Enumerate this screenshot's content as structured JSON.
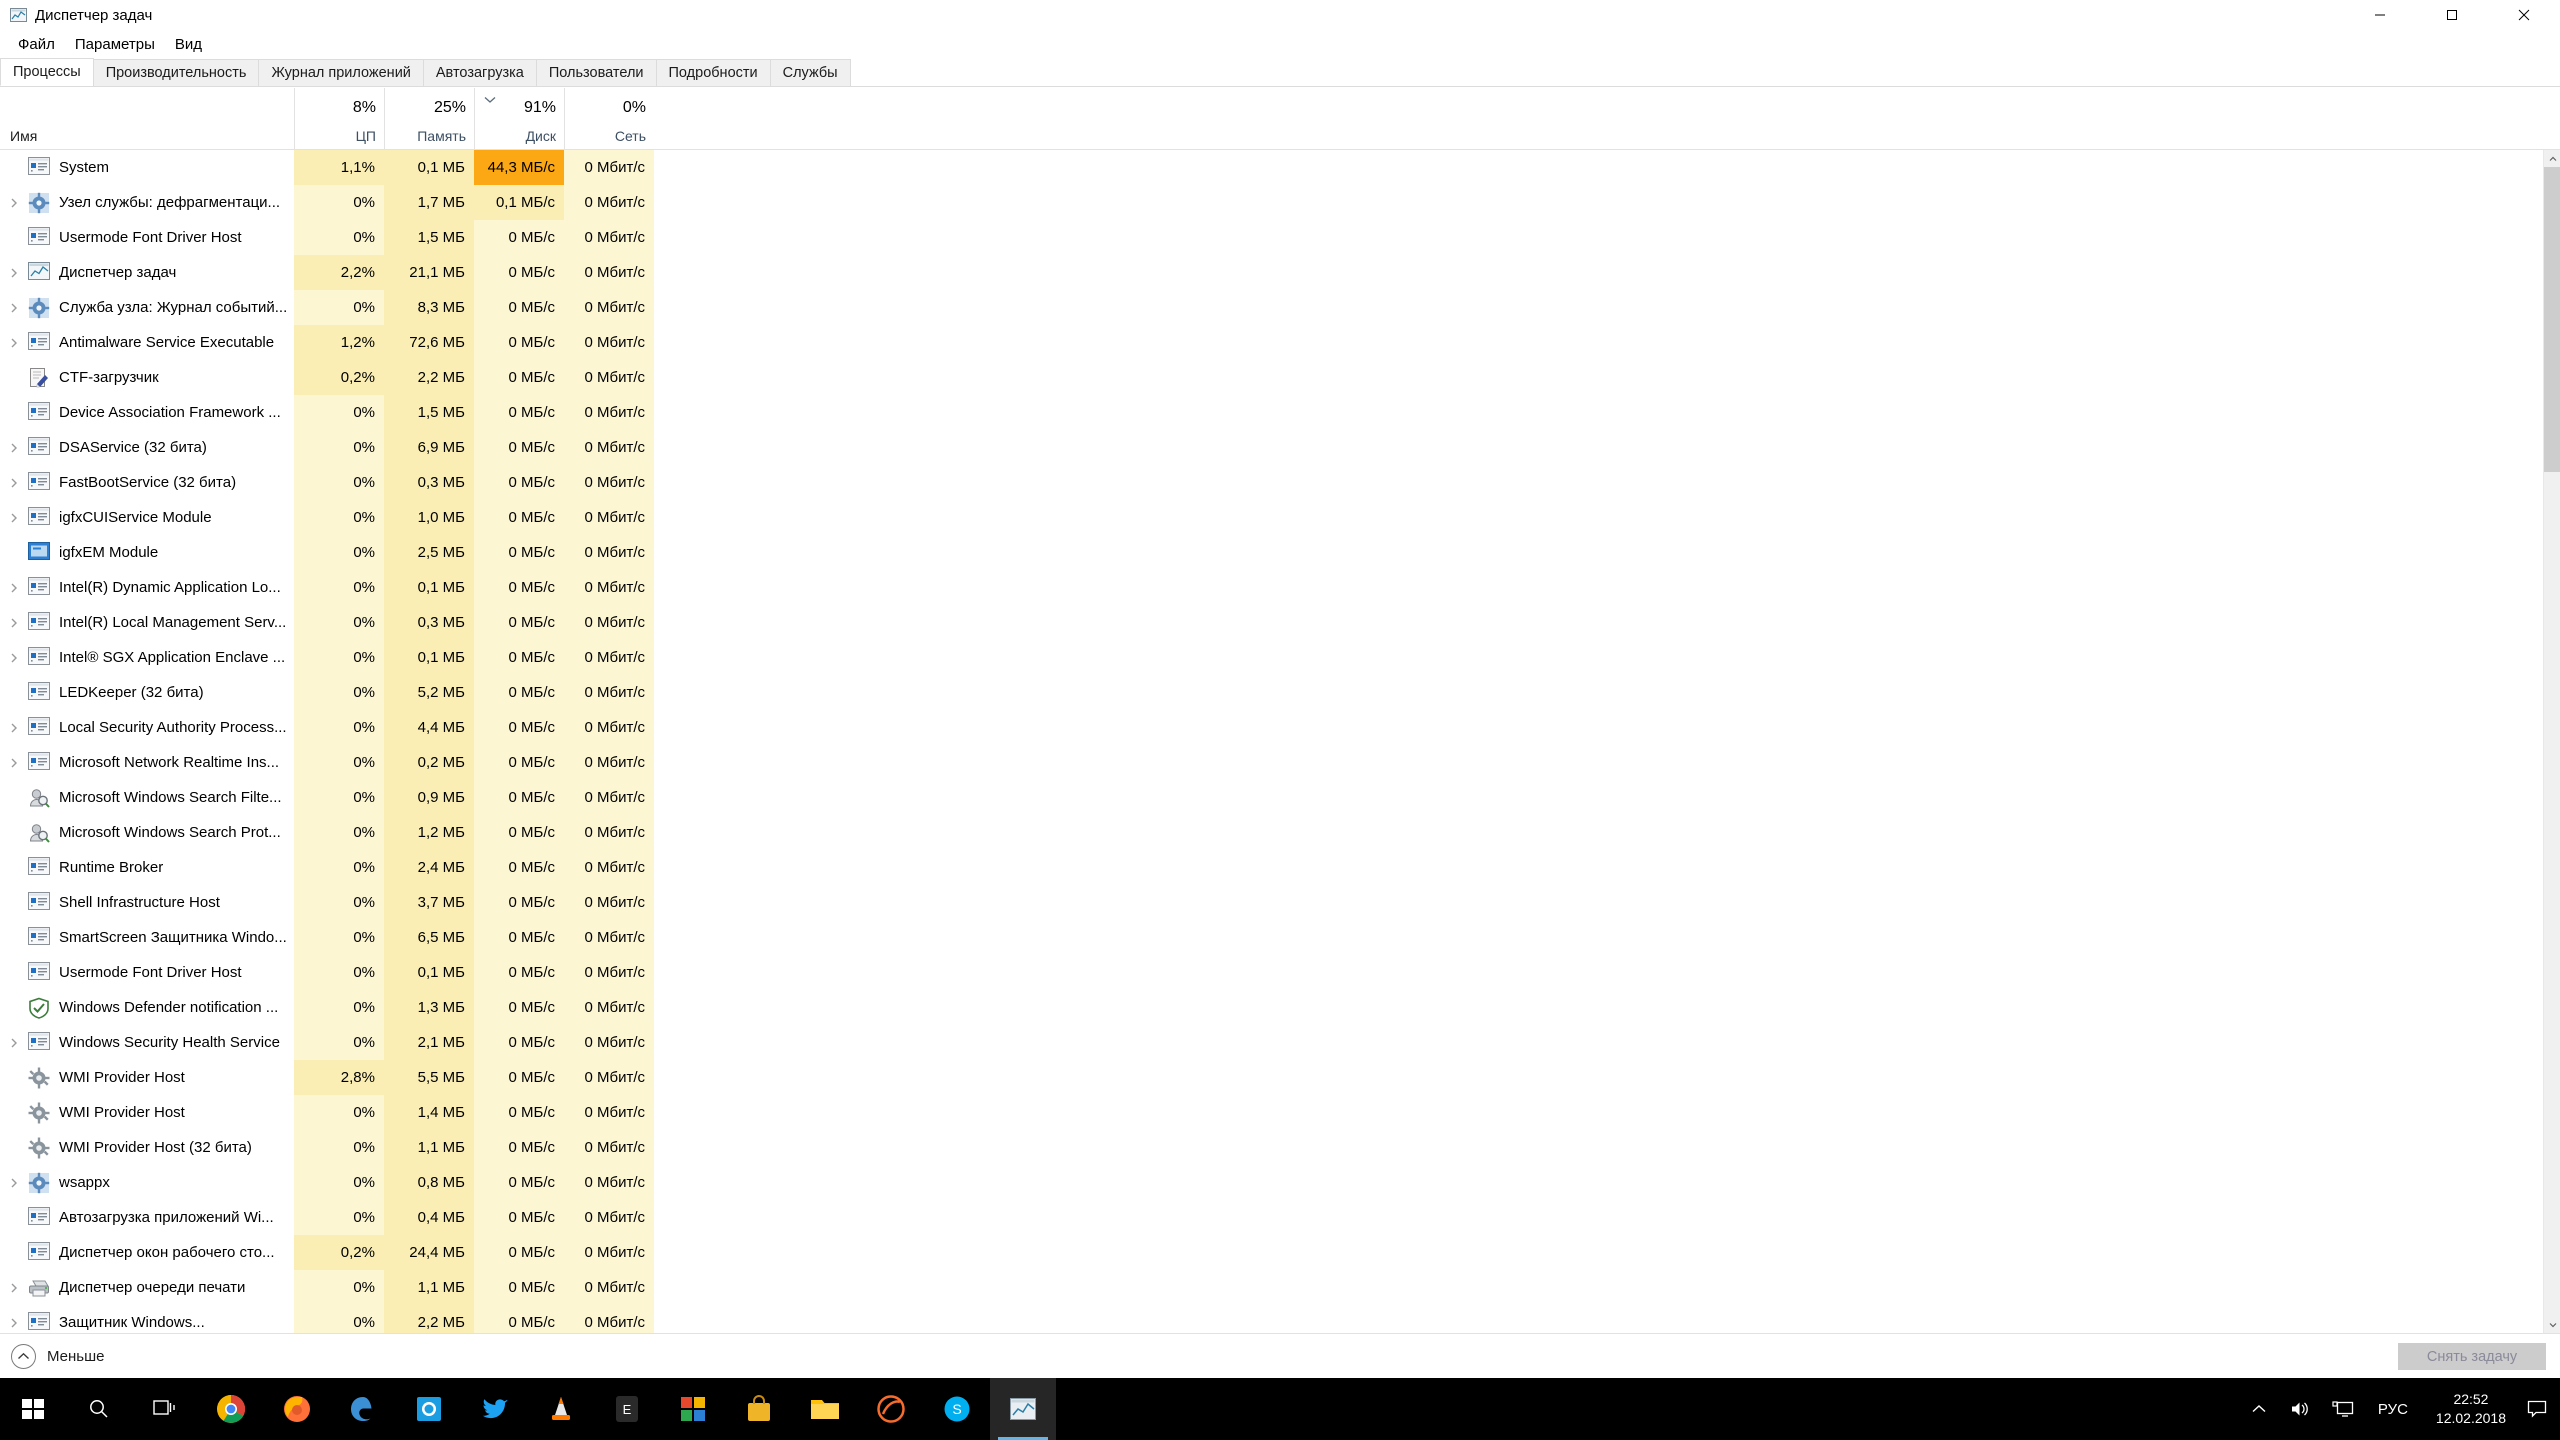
{
  "window": {
    "title": "Диспетчер задач",
    "icon": "task-manager-icon",
    "minimize_label": "—",
    "maximize_label": "▢",
    "close_label": "✕"
  },
  "menu": {
    "items": [
      {
        "label": "Файл"
      },
      {
        "label": "Параметры"
      },
      {
        "label": "Вид"
      }
    ]
  },
  "tabs": {
    "active_index": 0,
    "items": [
      {
        "label": "Процессы"
      },
      {
        "label": "Производительность"
      },
      {
        "label": "Журнал приложений"
      },
      {
        "label": "Автозагрузка"
      },
      {
        "label": "Пользователи"
      },
      {
        "label": "Подробности"
      },
      {
        "label": "Службы"
      }
    ]
  },
  "columns": [
    {
      "key": "name",
      "top": "",
      "label": "Имя",
      "sorted": false
    },
    {
      "key": "cpu",
      "top": "8%",
      "label": "ЦП",
      "sorted": false
    },
    {
      "key": "memory",
      "top": "25%",
      "label": "Память",
      "sorted": false
    },
    {
      "key": "disk",
      "top": "91%",
      "label": "Диск",
      "sorted": true
    },
    {
      "key": "net",
      "top": "0%",
      "label": "Сеть",
      "sorted": false
    }
  ],
  "sort": {
    "column": "disk",
    "direction": "descending",
    "indicator": "chevron-down-icon"
  },
  "processes": [
    {
      "name": "System",
      "icon": "window-icon",
      "expandable": false,
      "cpu": "1,1%",
      "memory": "0,1 МБ",
      "disk": "44,3 МБ/с",
      "net": "0 Мбит/с",
      "heat": {
        "cpu": 2,
        "memory": 2,
        "disk": 4,
        "net": 1
      }
    },
    {
      "name": "Узел службы: дефрагментаци...",
      "icon": "gear-icon",
      "expandable": true,
      "cpu": "0%",
      "memory": "1,7 МБ",
      "disk": "0,1 МБ/с",
      "net": "0 Мбит/с",
      "heat": {
        "cpu": 1,
        "memory": 2,
        "disk": 2,
        "net": 1
      }
    },
    {
      "name": "Usermode Font Driver Host",
      "icon": "window-icon",
      "expandable": false,
      "cpu": "0%",
      "memory": "1,5 МБ",
      "disk": "0 МБ/с",
      "net": "0 Мбит/с",
      "heat": {
        "cpu": 1,
        "memory": 2,
        "disk": 1,
        "net": 1
      }
    },
    {
      "name": "Диспетчер задач",
      "icon": "task-manager-icon",
      "expandable": true,
      "cpu": "2,2%",
      "memory": "21,1 МБ",
      "disk": "0 МБ/с",
      "net": "0 Мбит/с",
      "heat": {
        "cpu": 2,
        "memory": 2,
        "disk": 1,
        "net": 1
      }
    },
    {
      "name": "Служба узла: Журнал событий...",
      "icon": "gear-icon",
      "expandable": true,
      "cpu": "0%",
      "memory": "8,3 МБ",
      "disk": "0 МБ/с",
      "net": "0 Мбит/с",
      "heat": {
        "cpu": 1,
        "memory": 2,
        "disk": 1,
        "net": 1
      }
    },
    {
      "name": "Antimalware Service Executable",
      "icon": "window-icon",
      "expandable": true,
      "cpu": "1,2%",
      "memory": "72,6 МБ",
      "disk": "0 МБ/с",
      "net": "0 Мбит/с",
      "heat": {
        "cpu": 2,
        "memory": 2,
        "disk": 1,
        "net": 1
      }
    },
    {
      "name": "CTF-загрузчик",
      "icon": "pen-document-icon",
      "expandable": false,
      "cpu": "0,2%",
      "memory": "2,2 МБ",
      "disk": "0 МБ/с",
      "net": "0 Мбит/с",
      "heat": {
        "cpu": 2,
        "memory": 2,
        "disk": 1,
        "net": 1
      }
    },
    {
      "name": "Device Association Framework ...",
      "icon": "window-icon",
      "expandable": false,
      "cpu": "0%",
      "memory": "1,5 МБ",
      "disk": "0 МБ/с",
      "net": "0 Мбит/с",
      "heat": {
        "cpu": 1,
        "memory": 2,
        "disk": 1,
        "net": 1
      }
    },
    {
      "name": "DSAService (32 бита)",
      "icon": "window-icon",
      "expandable": true,
      "cpu": "0%",
      "memory": "6,9 МБ",
      "disk": "0 МБ/с",
      "net": "0 Мбит/с",
      "heat": {
        "cpu": 1,
        "memory": 2,
        "disk": 1,
        "net": 1
      }
    },
    {
      "name": "FastBootService (32 бита)",
      "icon": "window-icon",
      "expandable": true,
      "cpu": "0%",
      "memory": "0,3 МБ",
      "disk": "0 МБ/с",
      "net": "0 Мбит/с",
      "heat": {
        "cpu": 1,
        "memory": 2,
        "disk": 1,
        "net": 1
      }
    },
    {
      "name": "igfxCUIService Module",
      "icon": "window-icon",
      "expandable": true,
      "cpu": "0%",
      "memory": "1,0 МБ",
      "disk": "0 МБ/с",
      "net": "0 Мбит/с",
      "heat": {
        "cpu": 1,
        "memory": 2,
        "disk": 1,
        "net": 1
      }
    },
    {
      "name": "igfxEM Module",
      "icon": "blue-app-icon",
      "expandable": false,
      "cpu": "0%",
      "memory": "2,5 МБ",
      "disk": "0 МБ/с",
      "net": "0 Мбит/с",
      "heat": {
        "cpu": 1,
        "memory": 2,
        "disk": 1,
        "net": 1
      }
    },
    {
      "name": "Intel(R) Dynamic Application Lo...",
      "icon": "window-icon",
      "expandable": true,
      "cpu": "0%",
      "memory": "0,1 МБ",
      "disk": "0 МБ/с",
      "net": "0 Мбит/с",
      "heat": {
        "cpu": 1,
        "memory": 2,
        "disk": 1,
        "net": 1
      }
    },
    {
      "name": "Intel(R) Local Management Serv...",
      "icon": "window-icon",
      "expandable": true,
      "cpu": "0%",
      "memory": "0,3 МБ",
      "disk": "0 МБ/с",
      "net": "0 Мбит/с",
      "heat": {
        "cpu": 1,
        "memory": 2,
        "disk": 1,
        "net": 1
      }
    },
    {
      "name": "Intel® SGX Application Enclave ...",
      "icon": "window-icon",
      "expandable": true,
      "cpu": "0%",
      "memory": "0,1 МБ",
      "disk": "0 МБ/с",
      "net": "0 Мбит/с",
      "heat": {
        "cpu": 1,
        "memory": 2,
        "disk": 1,
        "net": 1
      }
    },
    {
      "name": "LEDKeeper (32 бита)",
      "icon": "window-icon",
      "expandable": false,
      "cpu": "0%",
      "memory": "5,2 МБ",
      "disk": "0 МБ/с",
      "net": "0 Мбит/с",
      "heat": {
        "cpu": 1,
        "memory": 2,
        "disk": 1,
        "net": 1
      }
    },
    {
      "name": "Local Security Authority Process...",
      "icon": "window-icon",
      "expandable": true,
      "cpu": "0%",
      "memory": "4,4 МБ",
      "disk": "0 МБ/с",
      "net": "0 Мбит/с",
      "heat": {
        "cpu": 1,
        "memory": 2,
        "disk": 1,
        "net": 1
      }
    },
    {
      "name": "Microsoft Network Realtime Ins...",
      "icon": "window-icon",
      "expandable": true,
      "cpu": "0%",
      "memory": "0,2 МБ",
      "disk": "0 МБ/с",
      "net": "0 Мбит/с",
      "heat": {
        "cpu": 1,
        "memory": 2,
        "disk": 1,
        "net": 1
      }
    },
    {
      "name": "Microsoft Windows Search Filte...",
      "icon": "search-person-icon",
      "expandable": false,
      "cpu": "0%",
      "memory": "0,9 МБ",
      "disk": "0 МБ/с",
      "net": "0 Мбит/с",
      "heat": {
        "cpu": 1,
        "memory": 2,
        "disk": 1,
        "net": 1
      }
    },
    {
      "name": "Microsoft Windows Search Prot...",
      "icon": "search-person-icon",
      "expandable": false,
      "cpu": "0%",
      "memory": "1,2 МБ",
      "disk": "0 МБ/с",
      "net": "0 Мбит/с",
      "heat": {
        "cpu": 1,
        "memory": 2,
        "disk": 1,
        "net": 1
      }
    },
    {
      "name": "Runtime Broker",
      "icon": "window-icon",
      "expandable": false,
      "cpu": "0%",
      "memory": "2,4 МБ",
      "disk": "0 МБ/с",
      "net": "0 Мбит/с",
      "heat": {
        "cpu": 1,
        "memory": 2,
        "disk": 1,
        "net": 1
      }
    },
    {
      "name": "Shell Infrastructure Host",
      "icon": "window-icon",
      "expandable": false,
      "cpu": "0%",
      "memory": "3,7 МБ",
      "disk": "0 МБ/с",
      "net": "0 Мбит/с",
      "heat": {
        "cpu": 1,
        "memory": 2,
        "disk": 1,
        "net": 1
      }
    },
    {
      "name": "SmartScreen Защитника Windo...",
      "icon": "window-icon",
      "expandable": false,
      "cpu": "0%",
      "memory": "6,5 МБ",
      "disk": "0 МБ/с",
      "net": "0 Мбит/с",
      "heat": {
        "cpu": 1,
        "memory": 2,
        "disk": 1,
        "net": 1
      }
    },
    {
      "name": "Usermode Font Driver Host",
      "icon": "window-icon",
      "expandable": false,
      "cpu": "0%",
      "memory": "0,1 МБ",
      "disk": "0 МБ/с",
      "net": "0 Мбит/с",
      "heat": {
        "cpu": 1,
        "memory": 2,
        "disk": 1,
        "net": 1
      }
    },
    {
      "name": "Windows Defender notification ...",
      "icon": "shield-icon",
      "expandable": false,
      "cpu": "0%",
      "memory": "1,3 МБ",
      "disk": "0 МБ/с",
      "net": "0 Мбит/с",
      "heat": {
        "cpu": 1,
        "memory": 2,
        "disk": 1,
        "net": 1
      }
    },
    {
      "name": "Windows Security Health Service",
      "icon": "window-icon",
      "expandable": true,
      "cpu": "0%",
      "memory": "2,1 МБ",
      "disk": "0 МБ/с",
      "net": "0 Мбит/с",
      "heat": {
        "cpu": 1,
        "memory": 2,
        "disk": 1,
        "net": 1
      }
    },
    {
      "name": "WMI Provider Host",
      "icon": "wmi-icon",
      "expandable": false,
      "cpu": "2,8%",
      "memory": "5,5 МБ",
      "disk": "0 МБ/с",
      "net": "0 Мбит/с",
      "heat": {
        "cpu": 2,
        "memory": 2,
        "disk": 1,
        "net": 1
      }
    },
    {
      "name": "WMI Provider Host",
      "icon": "wmi-icon",
      "expandable": false,
      "cpu": "0%",
      "memory": "1,4 МБ",
      "disk": "0 МБ/с",
      "net": "0 Мбит/с",
      "heat": {
        "cpu": 1,
        "memory": 2,
        "disk": 1,
        "net": 1
      }
    },
    {
      "name": "WMI Provider Host (32 бита)",
      "icon": "wmi-icon",
      "expandable": false,
      "cpu": "0%",
      "memory": "1,1 МБ",
      "disk": "0 МБ/с",
      "net": "0 Мбит/с",
      "heat": {
        "cpu": 1,
        "memory": 2,
        "disk": 1,
        "net": 1
      }
    },
    {
      "name": "wsappx",
      "icon": "gear-icon",
      "expandable": true,
      "cpu": "0%",
      "memory": "0,8 МБ",
      "disk": "0 МБ/с",
      "net": "0 Мбит/с",
      "heat": {
        "cpu": 1,
        "memory": 2,
        "disk": 1,
        "net": 1
      }
    },
    {
      "name": "Автозагрузка приложений Wi...",
      "icon": "window-icon",
      "expandable": false,
      "cpu": "0%",
      "memory": "0,4 МБ",
      "disk": "0 МБ/с",
      "net": "0 Мбит/с",
      "heat": {
        "cpu": 1,
        "memory": 2,
        "disk": 1,
        "net": 1
      }
    },
    {
      "name": "Диспетчер окон рабочего сто...",
      "icon": "window-icon",
      "expandable": false,
      "cpu": "0,2%",
      "memory": "24,4 МБ",
      "disk": "0 МБ/с",
      "net": "0 Мбит/с",
      "heat": {
        "cpu": 2,
        "memory": 2,
        "disk": 1,
        "net": 1
      }
    },
    {
      "name": "Диспетчер очереди печати",
      "icon": "printer-icon",
      "expandable": true,
      "cpu": "0%",
      "memory": "1,1 МБ",
      "disk": "0 МБ/с",
      "net": "0 Мбит/с",
      "heat": {
        "cpu": 1,
        "memory": 2,
        "disk": 1,
        "net": 1
      }
    },
    {
      "name": "Защитник Windows...",
      "icon": "window-icon",
      "expandable": true,
      "cpu": "0%",
      "memory": "2,2 МБ",
      "disk": "0 МБ/с",
      "net": "0 Мбит/с",
      "heat": {
        "cpu": 1,
        "memory": 2,
        "disk": 1,
        "net": 1
      }
    }
  ],
  "footer": {
    "less_label": "Меньше",
    "less_icon": "chevron-up-circle-icon",
    "end_task_label": "Снять задачу",
    "end_task_enabled": false
  },
  "taskbar": {
    "start_icon": "windows-start-icon",
    "search_icon": "search-icon",
    "taskview_icon": "task-view-icon",
    "apps": [
      {
        "name": "chrome-icon"
      },
      {
        "name": "firefox-icon"
      },
      {
        "name": "edge-icon"
      },
      {
        "name": "photos-icon"
      },
      {
        "name": "twitter-icon"
      },
      {
        "name": "vlc-cone-icon"
      },
      {
        "name": "epic-games-icon"
      },
      {
        "name": "gallery-icon"
      },
      {
        "name": "store-icon"
      },
      {
        "name": "file-explorer-icon"
      },
      {
        "name": "origin-icon"
      },
      {
        "name": "skype-icon"
      },
      {
        "name": "task-manager-icon"
      }
    ],
    "tray": {
      "chevron_icon": "chevron-up-icon",
      "volume_icon": "speaker-icon",
      "network_icon": "monitor-network-icon",
      "language": "РУС",
      "time": "22:52",
      "date": "12.02.2018",
      "notification_icon": "notification-icon"
    }
  },
  "scrollbar": {
    "up_arrow": "scroll-up-arrow",
    "down_arrow": "scroll-down-arrow"
  },
  "colors": {
    "heat_max": "#fca714",
    "heat_high": "#f7e49b",
    "heat_mid": "#faeeb4",
    "heat_low": "#fdf6d3",
    "accent": "#0078d7",
    "taskbar_bg": "#000000"
  }
}
